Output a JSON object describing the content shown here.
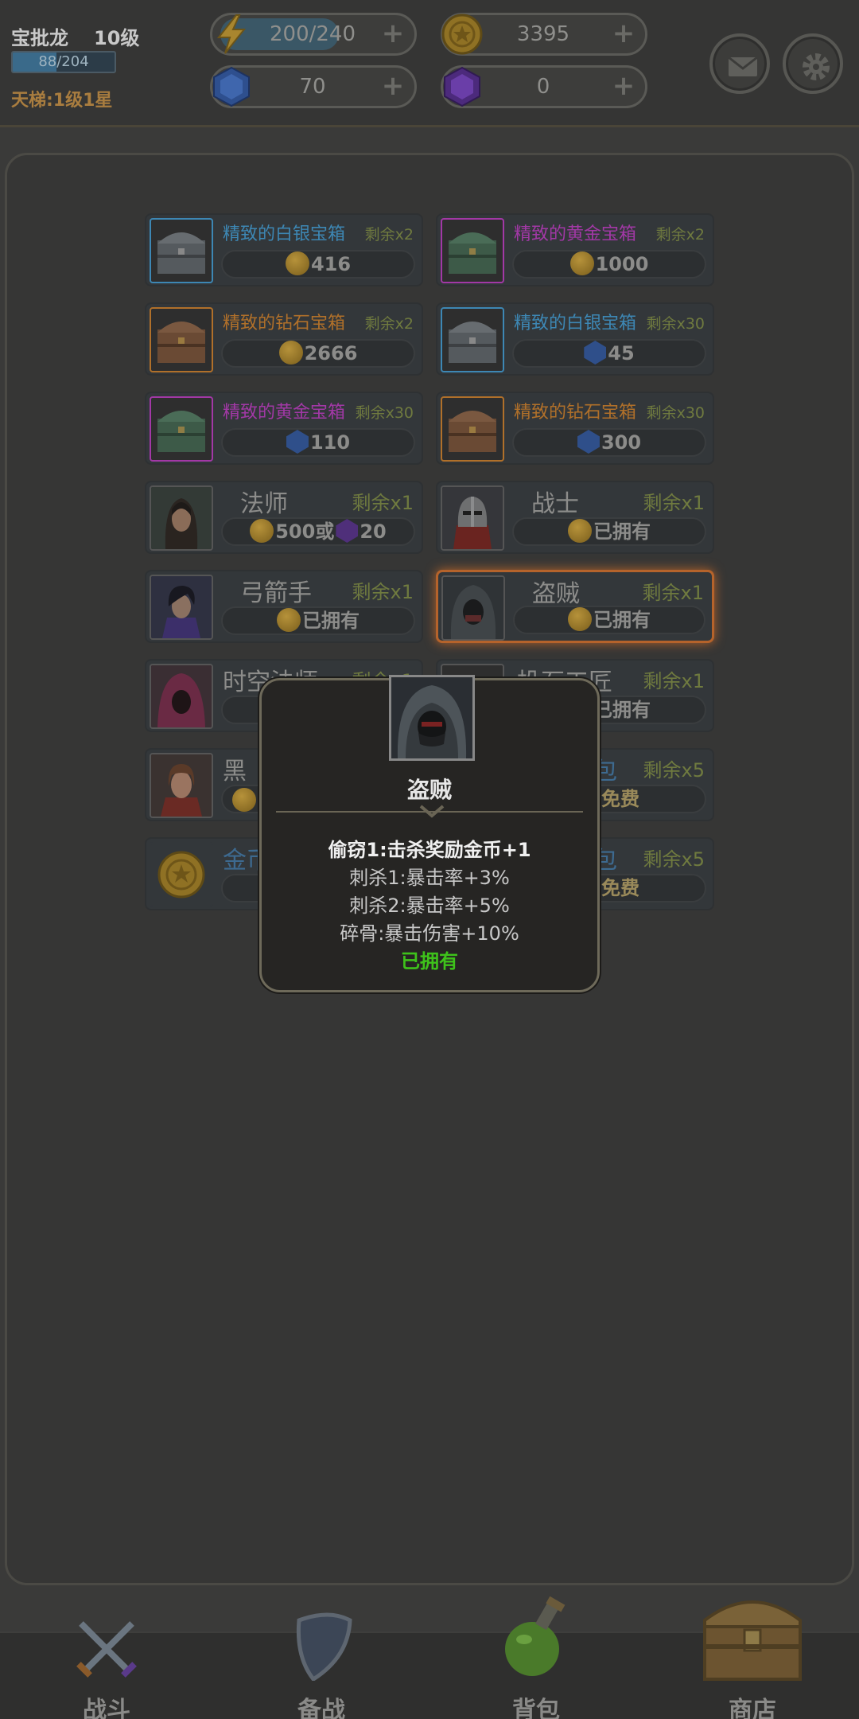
{
  "player": {
    "name": "宝批龙",
    "level": "10级",
    "xp": "88/204",
    "xp_fraction": 0.43,
    "ladder": "天梯:1级1星"
  },
  "resources": {
    "energy": {
      "value": "200/240",
      "fraction": 0.83,
      "icon": "lightning-icon"
    },
    "gold": {
      "value": "3395",
      "icon": "gold-coin-icon"
    },
    "gem": {
      "value": "70",
      "icon": "blue-gem-icon"
    },
    "purple_gem": {
      "value": "0",
      "icon": "purple-gem-icon"
    },
    "plus": "+"
  },
  "shop": {
    "items": [
      {
        "name": "精致的白银宝箱",
        "qty": "剩余x2",
        "price": "416",
        "currency": "coin",
        "color": "#3d87b4",
        "icon": "silver-chest-icon"
      },
      {
        "name": "精致的黄金宝箱",
        "qty": "剩余x2",
        "price": "1000",
        "currency": "coin",
        "color": "#a238a6",
        "icon": "gold-chest-icon"
      },
      {
        "name": "精致的钻石宝箱",
        "qty": "剩余x2",
        "price": "2666",
        "currency": "coin",
        "color": "#b0702a",
        "icon": "diamond-chest-icon"
      },
      {
        "name": "精致的白银宝箱",
        "qty": "剩余x30",
        "price": "45",
        "currency": "gem",
        "color": "#3d87b4",
        "icon": "silver-chest-icon"
      },
      {
        "name": "精致的黄金宝箱",
        "qty": "剩余x30",
        "price": "110",
        "currency": "gem",
        "color": "#a238a6",
        "icon": "gold-chest-icon"
      },
      {
        "name": "精致的钻石宝箱",
        "qty": "剩余x30",
        "price": "300",
        "currency": "gem",
        "color": "#b0702a",
        "icon": "diamond-chest-icon"
      },
      {
        "name": "法师",
        "qty": "剩余x1",
        "price_coin": "500",
        "or": "或",
        "price_gem": "20",
        "icon": "mage-portrait"
      },
      {
        "name": "战士",
        "qty": "剩余x1",
        "status": "已拥有",
        "icon": "warrior-portrait"
      },
      {
        "name": "弓箭手",
        "qty": "剩余x1",
        "status": "已拥有",
        "icon": "archer-portrait"
      },
      {
        "name": "盗贼",
        "qty": "剩余x1",
        "status": "已拥有",
        "icon": "thief-portrait"
      },
      {
        "name": "时空法师",
        "qty": "剩余x1",
        "icon": "chrono-mage-portrait"
      },
      {
        "name": "投石工匠",
        "qty": "剩余x1",
        "status": "已拥有",
        "icon": "stone-thrower-portrait"
      },
      {
        "name": "黑",
        "qty": "",
        "icon": "dark-hero-portrait"
      },
      {
        "name": "包",
        "qty": "剩余x5",
        "status": "免费",
        "icon": "pack-icon"
      },
      {
        "name": "金币",
        "qty": "",
        "icon": "gold-coin-icon"
      },
      {
        "name": "包",
        "qty": "剩余x5",
        "status": "免费",
        "icon": "pack-icon"
      }
    ]
  },
  "popup": {
    "title": "盗贼",
    "lines": [
      "偷窃1:击杀奖励金币+1",
      "刺杀1:暴击率+3%",
      "刺杀2:暴击率+5%",
      "碎骨:暴击伤害+10%"
    ],
    "status": "已拥有"
  },
  "nav": [
    {
      "label": "战斗",
      "icon": "crossed-swords-icon"
    },
    {
      "label": "备战",
      "icon": "shield-icon"
    },
    {
      "label": "背包",
      "icon": "potion-icon"
    },
    {
      "label": "商店",
      "icon": "treasure-chest-icon"
    }
  ]
}
